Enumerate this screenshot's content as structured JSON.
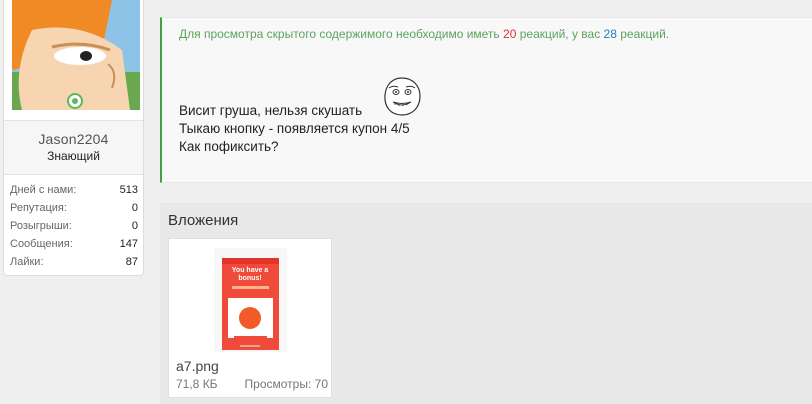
{
  "user": {
    "name": "Jason2204",
    "title": "Знающий",
    "stats": [
      {
        "label": "Дней с нами:",
        "value": "513"
      },
      {
        "label": "Репутация:",
        "value": "0"
      },
      {
        "label": "Розыгрыши:",
        "value": "0"
      },
      {
        "label": "Сообщения:",
        "value": "147"
      },
      {
        "label": "Лайки:",
        "value": "87"
      }
    ]
  },
  "post": {
    "notice_before": "Для просмотра скрытого содержимого необходимо иметь ",
    "notice_required": "20",
    "notice_middle": " реакций, у вас ",
    "notice_have": "28",
    "notice_after": " реакций.",
    "line1": "Висит груша, нельзя скушать",
    "line2": "Тыкаю кнопку - появляется купон 4/5",
    "line3": "Как пофиксить?"
  },
  "attachments": {
    "title": "Вложения",
    "files": [
      {
        "name": "a7.png",
        "size": "71,8 КБ",
        "views": "Просмотры: 70",
        "thumb_headline": "You have a bonus!"
      }
    ]
  },
  "colors": {
    "accent_green": "#44a048",
    "notice_red": "#dd3333",
    "notice_blue": "#2a7bbf",
    "thumb_red": "#f04a3a"
  }
}
